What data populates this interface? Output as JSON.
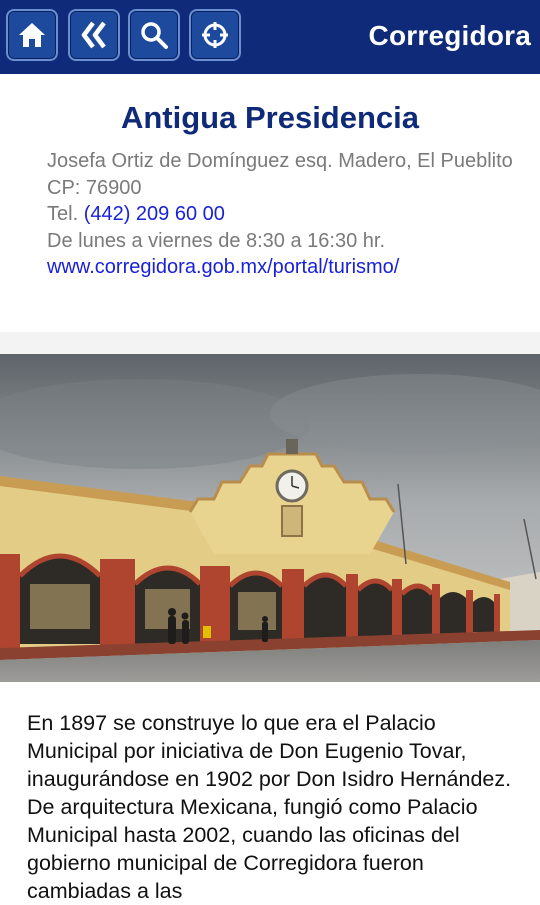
{
  "header": {
    "brand": "Corregidora",
    "buttons": [
      {
        "icon": "home-icon"
      },
      {
        "icon": "back-icon"
      },
      {
        "icon": "search-icon"
      },
      {
        "icon": "crosshair-icon"
      }
    ]
  },
  "place": {
    "title": "Antigua Presidencia",
    "address": "Josefa Ortiz de Domínguez esq. Madero, El Pueblito",
    "cp": "CP: 76900",
    "tel_prefix": "Tel. ",
    "tel": "(442) 209 60 00",
    "hours": "De lunes a viernes de 8:30 a 16:30 hr.",
    "website": "www.corregidora.gob.mx/portal/turismo/"
  },
  "photo": {
    "clock_text": ""
  },
  "description": "En 1897 se construye lo que era el Palacio Municipal por iniciativa de Don Eugenio Tovar, inaugurándose en 1902 por Don Isidro Hernández. De arquitectura Mexicana, fungió como Palacio Municipal hasta 2002, cuando las oficinas del gobierno municipal de Corregidora fueron cambiadas a las",
  "colors": {
    "header_bg": "#0e2a78",
    "title": "#0e2a78",
    "link": "#1a22d8",
    "facade": "#e7d08d",
    "arches": "#b0452f"
  }
}
